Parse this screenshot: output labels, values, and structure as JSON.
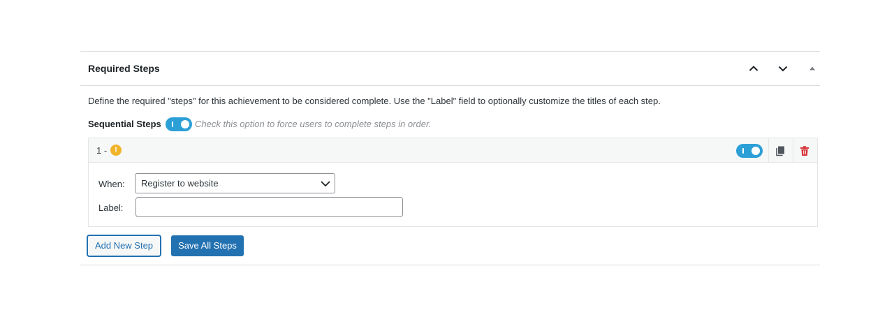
{
  "metabox": {
    "title": "Required Steps",
    "controls": [
      {
        "name": "move-up",
        "icon": "chevron-up-icon"
      },
      {
        "name": "move-down",
        "icon": "chevron-down-icon"
      },
      {
        "name": "toggle-panel",
        "icon": "triangle-up-icon"
      }
    ]
  },
  "description": "Define the required \"steps\" for this achievement to be considered complete. Use the \"Label\" field to optionally customize the titles of each step.",
  "sequential": {
    "label": "Sequential Steps",
    "enabled": true,
    "hint": "Check this option to force users to complete steps in order."
  },
  "steps": [
    {
      "number": "1 -",
      "status_icon": "warning-icon",
      "enabled": true,
      "when_label": "When:",
      "when_value": "Register to website",
      "label_label": "Label:",
      "label_value": ""
    }
  ],
  "buttons": {
    "add": "Add New Step",
    "save": "Save All Steps"
  },
  "colors": {
    "accent": "#2271b1",
    "toggle": "#2ca0d6",
    "warning": "#f0b429",
    "delete": "#d63638"
  }
}
